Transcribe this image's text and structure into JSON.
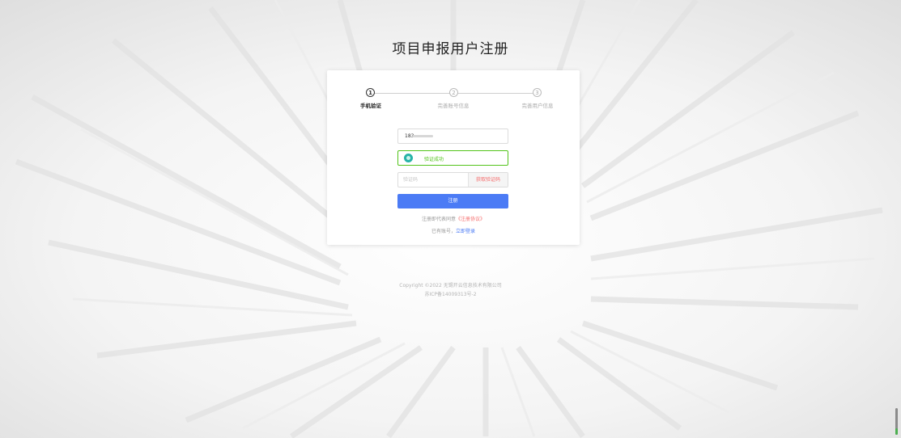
{
  "page": {
    "title": "项目申报用户注册"
  },
  "steps": [
    {
      "number": "1",
      "label": "手机验证",
      "active": true
    },
    {
      "number": "2",
      "label": "完善账号信息",
      "active": false
    },
    {
      "number": "3",
      "label": "完善用户信息",
      "active": false
    }
  ],
  "form": {
    "phone_value": "183",
    "verify_text": "验证成功",
    "code_placeholder": "验证码",
    "get_code_label": "获取验证码",
    "register_label": "注册",
    "agree_prefix": "注册即代表同意",
    "agree_link": "《注册协议》",
    "have_account_prefix": "已有账号，",
    "login_link": "立即登录"
  },
  "footer": {
    "copyright": "Copyright ©2022 无锡开云信息技术有限公司",
    "icp": "苏ICP备14009313号-2"
  },
  "colors": {
    "primary": "#4b7bf5",
    "success": "#52c41a",
    "danger": "#f56c6c"
  }
}
